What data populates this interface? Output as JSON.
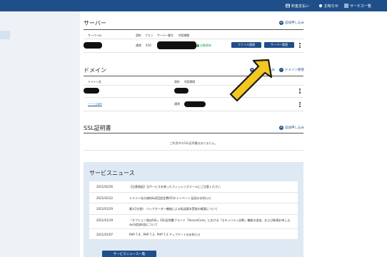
{
  "topbar": {
    "items": [
      {
        "icon": "payment-icon",
        "label": "料金支払い"
      },
      {
        "icon": "bell-icon",
        "label": "お知らせ"
      },
      {
        "icon": "grid-icon",
        "label": "サービス一覧"
      }
    ]
  },
  "server": {
    "title": "サーバー",
    "add_link": "追加申し込み",
    "headers": {
      "name": "サーバーID",
      "contract": "契約",
      "plan": "プラン",
      "number": "サーバー番号",
      "status": "利用期間"
    },
    "row": {
      "contract": "通常",
      "plan": "X10",
      "status": "自動更新"
    },
    "buttons": {
      "file": "ファイル管理",
      "server": "サーバー管理"
    }
  },
  "domain": {
    "title": "ドメイン",
    "add_link": "追加申し込み",
    "transfer_link": "ドメイン移管",
    "headers": {
      "name": "ドメイン名",
      "contract": "契約",
      "period": "利用期限"
    },
    "rows": [
      {
        "name": "",
        "contract": ""
      },
      {
        "name": "-------.com",
        "contract": "通常"
      }
    ]
  },
  "ssl": {
    "title": "SSL証明書",
    "add_link": "追加申し込み",
    "empty": "ご利用中のSSL証明書はありません。"
  },
  "news": {
    "title": "サービスニュース",
    "items": [
      {
        "date": "2021/02/26",
        "text": "【注意喚起】当サービスを装ったフィッシングメールにご注意ください"
      },
      {
        "date": "2021/02/22",
        "text": "ドメイン永久無料&初回設定費0円キャンペーン 延長のお知らせ"
      },
      {
        "date": "2021/01/29",
        "text": "最大2分割！ バックオーダー機能による転送基本受取の概要について"
      },
      {
        "date": "2021/01/19",
        "text": "「オプション独自SSL」SSL証明書ブランド「SecureCore」における「セキュリティ診断」機能の追加、および新規お申し込みの追加料金について"
      },
      {
        "date": "2021/01/07",
        "text": "PHP 7.4、PHP 7.3、PHP 7.2 アップデートのお知らせ"
      }
    ],
    "button": "サービスニュース一覧"
  }
}
